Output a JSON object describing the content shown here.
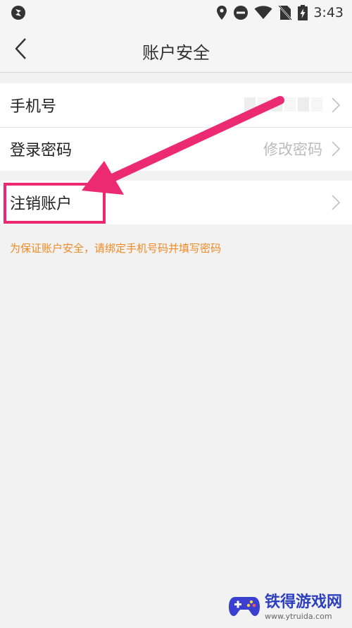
{
  "status_bar": {
    "time": "3:43",
    "icons": [
      "location-icon",
      "do-not-disturb-icon",
      "wifi-icon",
      "no-sim-icon",
      "battery-charging-icon"
    ]
  },
  "header": {
    "title": "账户安全",
    "back_icon": "chevron-left-icon"
  },
  "settings": {
    "items": [
      {
        "label": "手机号",
        "value": ""
      },
      {
        "label": "登录密码",
        "value": "修改密码"
      },
      {
        "label": "注销账户",
        "value": ""
      }
    ]
  },
  "notice": "为保证账户安全，请绑定手机号码并填写密码",
  "watermark": {
    "title": "铁得游戏网",
    "url": "www.ytruida.com"
  },
  "colors": {
    "annotation": "#ec2a73",
    "notice": "#f08a24",
    "background": "#f2f2f2"
  }
}
